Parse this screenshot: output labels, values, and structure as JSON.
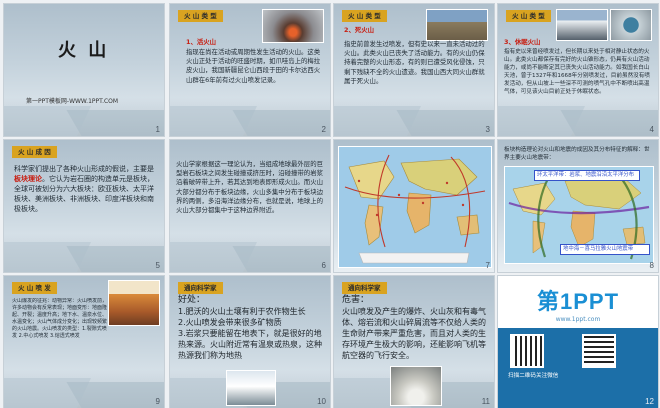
{
  "slides": [
    {
      "num": "1",
      "title": "火 山",
      "credit": "第一PPT模板网-WWW.1PPT.COM"
    },
    {
      "num": "2",
      "tag": "火 山 类 型",
      "heading": "1、活火山",
      "body": "指现在尚在活动或周期性发生活动的火山。这类火山正处于活动的旺盛时期，如爪哇岛上的梅拉皮火山，我国新疆昆仑山西段于田的卡尔达西火山群在6年前有过火山喷发记录。"
    },
    {
      "num": "3",
      "tag": "火 山 类 型",
      "heading": "2、死火山",
      "body": "指史前曾发生过喷发，但有史以来一直未活动过的火山。此类火山已丧失了活动能力。有的火山仍保持着完整的火山形态，有的则已遭受风化侵蚀，只剩下残缺不全的火山遗迹。我国山西大同火山群就属于死火山。",
      "photo_caption": "死火山"
    },
    {
      "num": "4",
      "tag": "火 山 类 型",
      "heading": "3、休眠火山",
      "body": "指有史以来曾经喷发过，但长期以来处于相对静止状态的火山。此类火山都保存有完好的火山锥形态，仍具有火山活动能力，或尚不能断定其已丧失火山活动能力。如我国长白山天池，曾于1327年和1668年分别喷发过，目前虽然没有喷发活动，但从山坡上一些深不可测的喷气孔中不断喷出高温气体，可见该火山目前正处于休眠状态。"
    },
    {
      "num": "5",
      "tag": "火 山 成 因",
      "body": "科学家们提出了各种火山形成的假说，主要是板块理论。它认为岩石圈的构造单元是板块，全球可被划分为六大板块：欧亚板块、太平洋板块、美洲板块、非洲板块、印度洋板块和南极板块。",
      "highlight": "板块理论"
    },
    {
      "num": "6",
      "body": "火山学家根据这一理论认为，当组成地球最外层的巨型岩石板块之间发生碰撞或挤压时，沿碰撞带的岩浆沿着破碎带上升，若其达到地表即形成火山。而火山大部分都分布于板块边缘，火山多集中分布于板块边界的两侧，多沿海洋边缘分布，也就是说，地球上的火山大部分都集中于这种边界附近。"
    },
    {
      "num": "7",
      "body": "",
      "map_note_1": "板块构造及火山地震分布示意图，火山和地震活动频繁的带，世界主要火山地震带：",
      "label_pacific": "环太平洋火山地震带",
      "label_med": "地中海－喜马拉雅火山地震带"
    },
    {
      "num": "8",
      "body": "板块构造理论对火山和地震的成因及其分布特征的解释：世界主要火山地震带：",
      "band1": "环太平洋带：岩浆、地震沿沿太平洋分布",
      "band2": "地中海－喜马拉雅火山地震带"
    },
    {
      "num": "9",
      "tag": "火 山 喷 发",
      "body": "火山爆发的征兆：动物异常：火山喷发前，许多动物会有反常表现；地面变形：地面隆起、开裂；温度升高；地下水、温泉水位、水温变化；火山气体成分变化；出现较频繁的火山地震。火山喷发的类型：1.裂隙式喷发 2.中心式喷发 3.熔透式喷发"
    },
    {
      "num": "10",
      "tag": "通向科学家",
      "heading": "好处：",
      "items": [
        "1.肥沃的火山土壤有利于农作物生长",
        "2.火山喷发会带来很多矿物质",
        "3.岩浆只要能留在地表下，就是很好的地热来源。火山附近常有温泉或热泉，这种热源我们称为地热"
      ]
    },
    {
      "num": "11",
      "tag": "通向科学家",
      "heading": "危害：",
      "body": "火山喷发及产生的爆炸、火山灰和有毒气体、熔岩流和火山碎屑流等不仅给人类的生命财产带来严重危害，而且对人类的生存环境产生极大的影响，还能影响飞机等航空器的飞行安全。"
    },
    {
      "num": "12",
      "brand": "第1PPT",
      "brand_sub": "www.1ppt.com",
      "qr_note": "扫描二维码关注微信"
    }
  ]
}
